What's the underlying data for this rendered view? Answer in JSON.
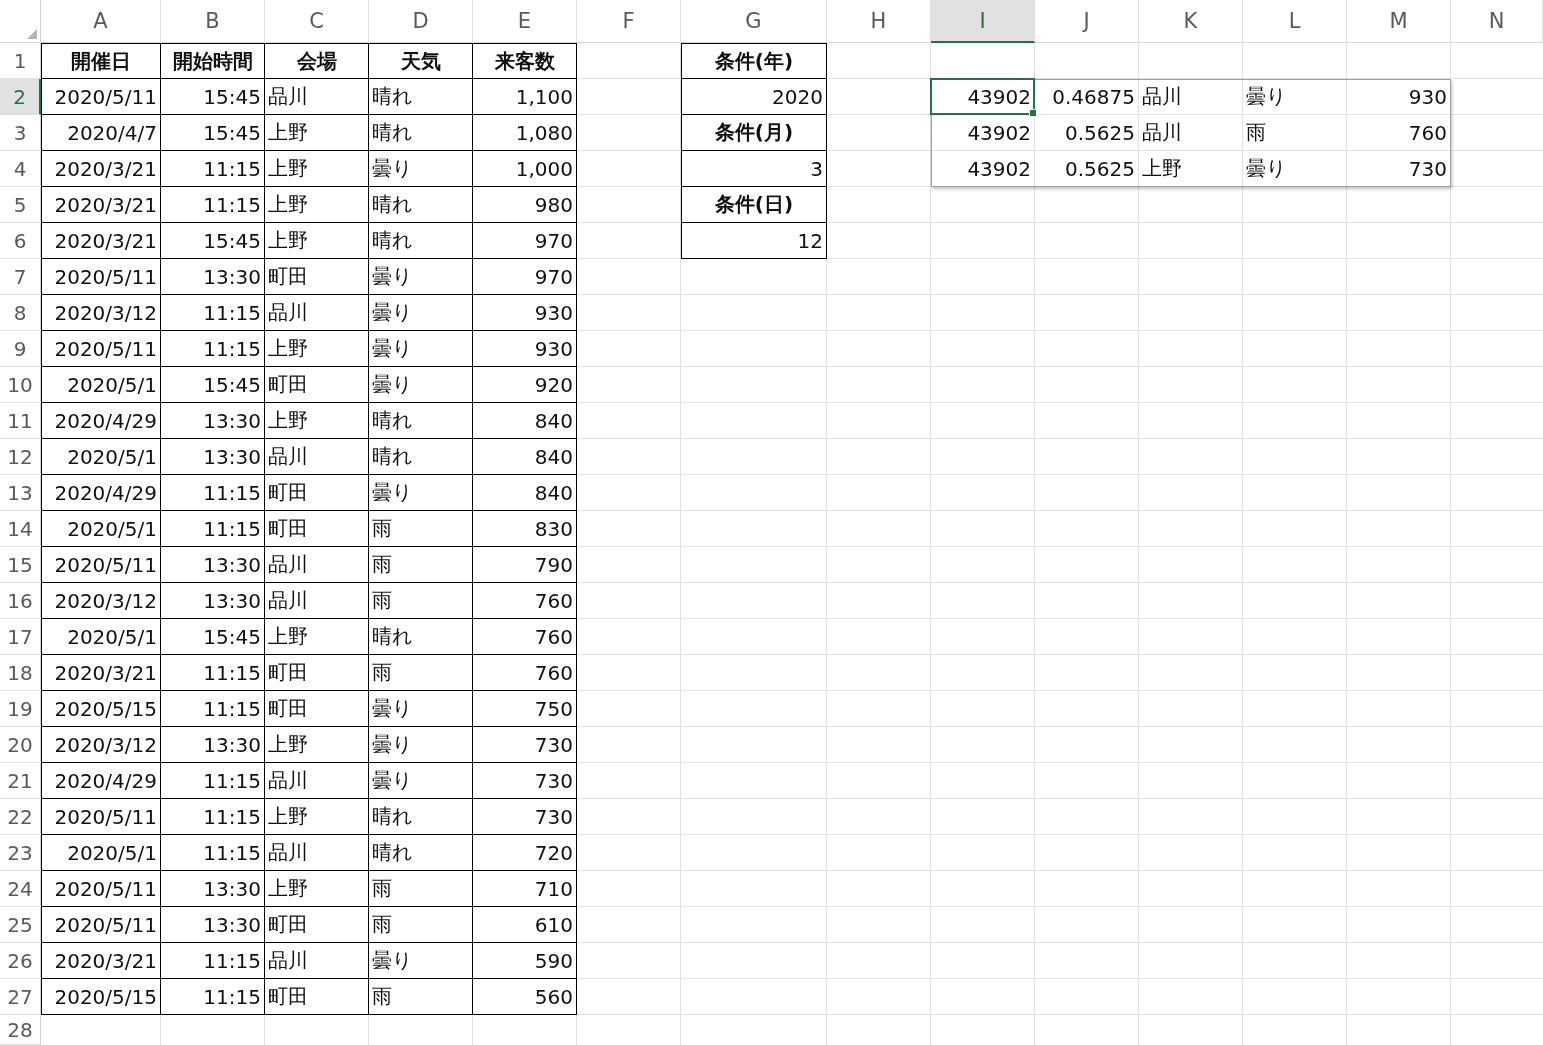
{
  "columns": [
    {
      "label": "A",
      "selected": false
    },
    {
      "label": "B",
      "selected": false
    },
    {
      "label": "C",
      "selected": false
    },
    {
      "label": "D",
      "selected": false
    },
    {
      "label": "E",
      "selected": false
    },
    {
      "label": "F",
      "selected": false
    },
    {
      "label": "G",
      "selected": false
    },
    {
      "label": "H",
      "selected": false
    },
    {
      "label": "I",
      "selected": true
    },
    {
      "label": "J",
      "selected": false
    },
    {
      "label": "K",
      "selected": false
    },
    {
      "label": "L",
      "selected": false
    },
    {
      "label": "M",
      "selected": false
    },
    {
      "label": "N",
      "selected": false
    }
  ],
  "row_numbers": [
    {
      "label": "1",
      "selected": false
    },
    {
      "label": "2",
      "selected": true
    },
    {
      "label": "3",
      "selected": false
    },
    {
      "label": "4",
      "selected": false
    },
    {
      "label": "5",
      "selected": false
    },
    {
      "label": "6",
      "selected": false
    },
    {
      "label": "7",
      "selected": false
    },
    {
      "label": "8",
      "selected": false
    },
    {
      "label": "9",
      "selected": false
    },
    {
      "label": "10",
      "selected": false
    },
    {
      "label": "11",
      "selected": false
    },
    {
      "label": "12",
      "selected": false
    },
    {
      "label": "13",
      "selected": false
    },
    {
      "label": "14",
      "selected": false
    },
    {
      "label": "15",
      "selected": false
    },
    {
      "label": "16",
      "selected": false
    },
    {
      "label": "17",
      "selected": false
    },
    {
      "label": "18",
      "selected": false
    },
    {
      "label": "19",
      "selected": false
    },
    {
      "label": "20",
      "selected": false
    },
    {
      "label": "21",
      "selected": false
    },
    {
      "label": "22",
      "selected": false
    },
    {
      "label": "23",
      "selected": false
    },
    {
      "label": "24",
      "selected": false
    },
    {
      "label": "25",
      "selected": false
    },
    {
      "label": "26",
      "selected": false
    },
    {
      "label": "27",
      "selected": false
    },
    {
      "label": "28",
      "selected": false
    }
  ],
  "table": {
    "columns": [
      {
        "header": "開催日",
        "kind": "number"
      },
      {
        "header": "開始時間",
        "kind": "number"
      },
      {
        "header": "会場",
        "kind": "text"
      },
      {
        "header": "天気",
        "kind": "text"
      },
      {
        "header": "来客数",
        "kind": "number"
      }
    ],
    "rows": [
      [
        "2020/5/11",
        "15:45",
        "品川",
        "晴れ",
        "1,100"
      ],
      [
        "2020/4/7",
        "15:45",
        "上野",
        "晴れ",
        "1,080"
      ],
      [
        "2020/3/21",
        "11:15",
        "上野",
        "曇り",
        "1,000"
      ],
      [
        "2020/3/21",
        "11:15",
        "上野",
        "晴れ",
        "980"
      ],
      [
        "2020/3/21",
        "15:45",
        "上野",
        "晴れ",
        "970"
      ],
      [
        "2020/5/11",
        "13:30",
        "町田",
        "曇り",
        "970"
      ],
      [
        "2020/3/12",
        "11:15",
        "品川",
        "曇り",
        "930"
      ],
      [
        "2020/5/11",
        "11:15",
        "上野",
        "曇り",
        "930"
      ],
      [
        "2020/5/1",
        "15:45",
        "町田",
        "曇り",
        "920"
      ],
      [
        "2020/4/29",
        "13:30",
        "上野",
        "晴れ",
        "840"
      ],
      [
        "2020/5/1",
        "13:30",
        "品川",
        "晴れ",
        "840"
      ],
      [
        "2020/4/29",
        "11:15",
        "町田",
        "曇り",
        "840"
      ],
      [
        "2020/5/1",
        "11:15",
        "町田",
        "雨",
        "830"
      ],
      [
        "2020/5/11",
        "13:30",
        "品川",
        "雨",
        "790"
      ],
      [
        "2020/3/12",
        "13:30",
        "品川",
        "雨",
        "760"
      ],
      [
        "2020/5/1",
        "15:45",
        "上野",
        "晴れ",
        "760"
      ],
      [
        "2020/3/21",
        "11:15",
        "町田",
        "雨",
        "760"
      ],
      [
        "2020/5/15",
        "11:15",
        "町田",
        "曇り",
        "750"
      ],
      [
        "2020/3/12",
        "13:30",
        "上野",
        "曇り",
        "730"
      ],
      [
        "2020/4/29",
        "11:15",
        "品川",
        "曇り",
        "730"
      ],
      [
        "2020/5/11",
        "11:15",
        "上野",
        "晴れ",
        "730"
      ],
      [
        "2020/5/1",
        "11:15",
        "品川",
        "晴れ",
        "720"
      ],
      [
        "2020/5/11",
        "13:30",
        "上野",
        "雨",
        "710"
      ],
      [
        "2020/5/11",
        "13:30",
        "町田",
        "雨",
        "610"
      ],
      [
        "2020/3/21",
        "11:15",
        "品川",
        "曇り",
        "590"
      ],
      [
        "2020/5/15",
        "11:15",
        "町田",
        "雨",
        "560"
      ]
    ]
  },
  "conditions": [
    {
      "label": "条件(年)",
      "value": "2020"
    },
    {
      "label": "条件(月)",
      "value": "3"
    },
    {
      "label": "条件(日)",
      "value": "12"
    }
  ],
  "results": {
    "columns": [
      {
        "kind": "number"
      },
      {
        "kind": "number"
      },
      {
        "kind": "text"
      },
      {
        "kind": "text"
      },
      {
        "kind": "number"
      }
    ],
    "rows": [
      {
        "cells": [
          {
            "text": "43902",
            "selected": true
          },
          {
            "text": "0.46875",
            "selected": false
          },
          {
            "text": "品川",
            "selected": false
          },
          {
            "text": "曇り",
            "selected": false
          },
          {
            "text": "930",
            "selected": false
          }
        ]
      },
      {
        "cells": [
          {
            "text": "43902",
            "selected": false
          },
          {
            "text": "0.5625",
            "selected": false
          },
          {
            "text": "品川",
            "selected": false
          },
          {
            "text": "雨",
            "selected": false
          },
          {
            "text": "760",
            "selected": false
          }
        ]
      },
      {
        "cells": [
          {
            "text": "43902",
            "selected": false
          },
          {
            "text": "0.5625",
            "selected": false
          },
          {
            "text": "上野",
            "selected": false
          },
          {
            "text": "曇り",
            "selected": false
          },
          {
            "text": "730",
            "selected": false
          }
        ]
      }
    ]
  }
}
